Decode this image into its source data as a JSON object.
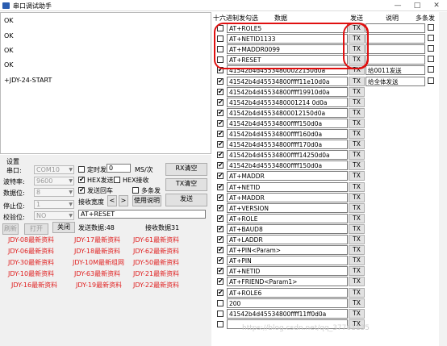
{
  "window": {
    "title": "串口调试助手",
    "minimize": "—",
    "maximize": "□",
    "close": "✕"
  },
  "log": {
    "lines": [
      "OK",
      "OK",
      "OK",
      "OK",
      "+JDY-24-START"
    ]
  },
  "settings": {
    "group_label": "设置",
    "port_label": "串口:",
    "port_value": "COM10",
    "baud_label": "波特率:",
    "baud_value": "9600",
    "databits_label": "数据位:",
    "databits_value": "8",
    "stopbits_label": "停止位:",
    "stopbits_value": "1",
    "parity_label": "校验位:",
    "parity_value": "NO",
    "connect_label": "刷新",
    "open_label": "打开",
    "close_label": "关闭",
    "timed_send_label": "定时发",
    "timed_send_value": "0",
    "timed_unit": "MS/次",
    "hex_send_label": "HEX发送",
    "hex_recv_label": "HEX接收",
    "send_newline_label": "发送回车",
    "multi_send_label": "多条发",
    "recv_width_label": "接收宽度",
    "prev": "<",
    "next": ">",
    "usage_label": "使用说明",
    "rx_clear": "RX清空",
    "tx_clear": "TX清空",
    "send": "发送",
    "send_input": "AT+RESET",
    "send_count": "发送数据:48",
    "recv_count": "接收数据31"
  },
  "links": [
    "JDY-08最新资料",
    "JDY-17最新资料",
    "JDY-61最新资料",
    "JDY-06最新资料",
    "JDY-18最新资料",
    "JDY-62最新资料",
    "JDY-30最新资料",
    "JDY-10M最新组网",
    "JDY-50最新资料",
    "JDY-10最新资料",
    "JDY-63最新资料",
    "JDY-21最新资料",
    "JDY-16最新资料",
    "JDY-19最新资料",
    "JDY-22最新资料"
  ],
  "multi": {
    "header_hex": "十六进制发勾选",
    "header_data": "数据",
    "header_send": "发送",
    "header_note": "说明",
    "header_multi": "多条发",
    "tx_label": "TX",
    "rows": [
      {
        "checked": false,
        "data": "AT+ROLE5",
        "note": ""
      },
      {
        "checked": false,
        "data": "AT+NETID1133",
        "note": ""
      },
      {
        "checked": false,
        "data": "AT+MADDR0099",
        "note": ""
      },
      {
        "checked": false,
        "data": "AT+RESET",
        "note": ""
      },
      {
        "checked": true,
        "data": "41542b4d45534800022150d0a",
        "note": "给0011发送"
      },
      {
        "checked": true,
        "data": "41542b4d45534800ffff11e10d0a",
        "note": "给全体发送"
      },
      {
        "checked": true,
        "data": "41542b4d45534800ffff19910d0a",
        "note": ""
      },
      {
        "checked": true,
        "data": "41542b4d4553480001214 0d0a",
        "note": ""
      },
      {
        "checked": true,
        "data": "41542b4d45534800012150d0a",
        "note": ""
      },
      {
        "checked": true,
        "data": "41542b4d45534800ffff150d0a",
        "note": ""
      },
      {
        "checked": true,
        "data": "41542b4d45534800ffff160d0a",
        "note": ""
      },
      {
        "checked": true,
        "data": "41542b4d45534800ffff170d0a",
        "note": ""
      },
      {
        "checked": true,
        "data": "41542b4d45534800ffff14250d0a",
        "note": ""
      },
      {
        "checked": true,
        "data": "41542b4d45534800ffff150d0a",
        "note": ""
      },
      {
        "checked": true,
        "data": "AT+MADDR",
        "note": ""
      },
      {
        "checked": true,
        "data": "AT+NETID",
        "note": ""
      },
      {
        "checked": true,
        "data": "AT+MADDR",
        "note": ""
      },
      {
        "checked": true,
        "data": "AT+VERSION",
        "note": ""
      },
      {
        "checked": true,
        "data": "AT+ROLE",
        "note": ""
      },
      {
        "checked": true,
        "data": "AT+BAUD8",
        "note": ""
      },
      {
        "checked": true,
        "data": "AT+LADDR",
        "note": ""
      },
      {
        "checked": true,
        "data": "AT+PIN<Param>",
        "note": ""
      },
      {
        "checked": true,
        "data": "AT+PIN",
        "note": ""
      },
      {
        "checked": true,
        "data": "AT+NETID",
        "note": ""
      },
      {
        "checked": true,
        "data": "AT+FRIEND<Param1>",
        "note": ""
      },
      {
        "checked": true,
        "data": "AT+ROLE6",
        "note": ""
      },
      {
        "checked": false,
        "data": "200",
        "note": ""
      },
      {
        "checked": false,
        "data": "41542b4d45534800ffff11ff0d0a",
        "note": ""
      },
      {
        "checked": false,
        "data": "",
        "note": ""
      }
    ]
  },
  "watermark": "https://blog.csdn.net/qq_37761135",
  "colors": {
    "highlight": "#e01010",
    "link": "#e02020"
  }
}
